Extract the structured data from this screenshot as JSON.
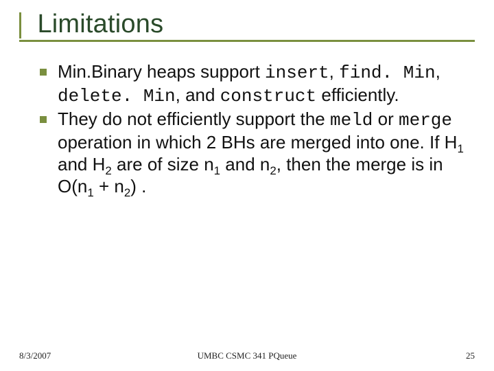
{
  "title": "Limitations",
  "bullets": [
    {
      "t1": "Min.Binary heaps support ",
      "c1": "insert",
      "t2": ", ",
      "c2": "find. Min",
      "t3": ", ",
      "c3": "delete. Min",
      "t4": ", and ",
      "c4": "construct",
      "t5": " efficiently."
    },
    {
      "t1": "They do not efficiently support the ",
      "c1": "meld",
      "t2": " or ",
      "c2": "merge",
      "t3": " operation in which 2 BHs are merged into one. If H",
      "s1": "1",
      "t4": " and H",
      "s2": "2",
      "t5": " are of size n",
      "s3": "1",
      "t6": " and n",
      "s4": "2",
      "t7": ", then the merge is in O(n",
      "s5": "1",
      "t8": " + n",
      "s6": "2",
      "t9": ") ."
    }
  ],
  "footer": {
    "date": "8/3/2007",
    "center": "UMBC CSMC 341 PQueue",
    "page": "25"
  }
}
